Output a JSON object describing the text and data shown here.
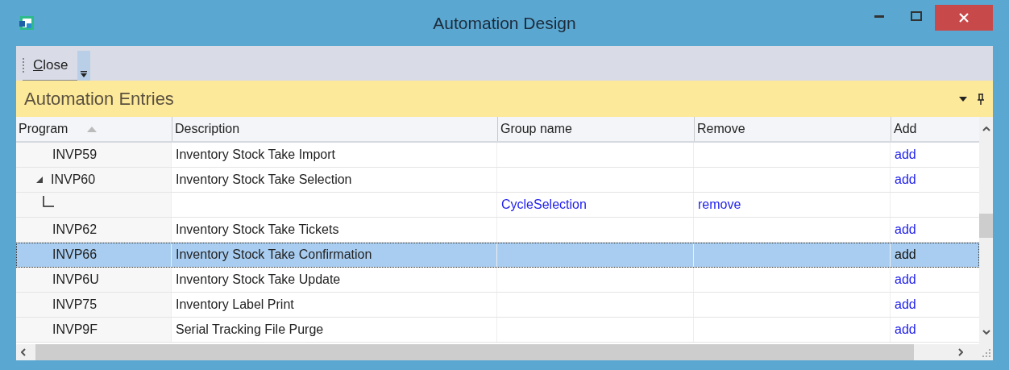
{
  "window": {
    "title": "Automation Design"
  },
  "toolbar": {
    "close_button": {
      "label": "Close",
      "mnemonic_underlined": true
    }
  },
  "panel": {
    "title": "Automation Entries"
  },
  "table": {
    "columns": [
      {
        "label": "Program",
        "sorted": true
      },
      {
        "label": "Description",
        "sorted": false
      },
      {
        "label": "Group name",
        "sorted": false
      },
      {
        "label": "Remove",
        "sorted": false
      },
      {
        "label": "Add",
        "sorted": false
      }
    ],
    "rows": [
      {
        "kind": "program",
        "program": "INVP59",
        "description": "Inventory Stock Take Import",
        "add": "add",
        "selected": false
      },
      {
        "kind": "program",
        "program": "INVP60",
        "description": "Inventory Stock Take Selection",
        "add": "add",
        "selected": false,
        "expanded": true
      },
      {
        "kind": "child",
        "group_name": "CycleSelection",
        "remove": "remove",
        "selected": false
      },
      {
        "kind": "program",
        "program": "INVP62",
        "description": "Inventory Stock Take Tickets",
        "add": "add",
        "selected": false
      },
      {
        "kind": "program",
        "program": "INVP66",
        "description": "Inventory Stock Take Confirmation",
        "add": "add",
        "selected": true
      },
      {
        "kind": "program",
        "program": "INVP6U",
        "description": "Inventory Stock Take Update",
        "add": "add",
        "selected": false
      },
      {
        "kind": "program",
        "program": "INVP75",
        "description": "Inventory Label Print",
        "add": "add",
        "selected": false
      },
      {
        "kind": "program",
        "program": "INVP9F",
        "description": "Serial Tracking File Purge",
        "add": "add",
        "selected": false
      }
    ]
  }
}
